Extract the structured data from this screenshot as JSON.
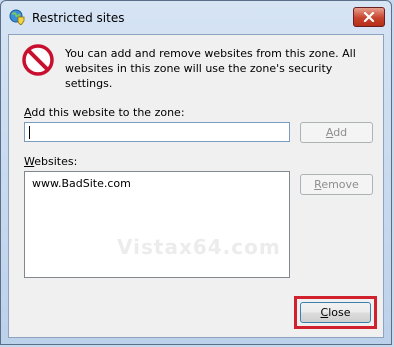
{
  "window": {
    "title": "Restricted sites"
  },
  "message": "You can add and remove websites from this zone. All websites in this zone will use the zone's security settings.",
  "add_section": {
    "label_access_key": "A",
    "label_rest": "dd this website to the zone:",
    "input_value": "",
    "add_button_access_key": "A",
    "add_button_rest": "dd"
  },
  "sites_section": {
    "label_access_key": "W",
    "label_rest": "ebsites:",
    "items": [
      "www.BadSite.com"
    ],
    "remove_button_access_key": "R",
    "remove_button_rest": "emove"
  },
  "close_button": {
    "access_key": "C",
    "rest": "lose"
  },
  "watermark": "Vistax64.com",
  "colors": {
    "highlight_box": "#d1212f",
    "no_entry_icon": "#c8102e"
  },
  "icons": [
    "globe-shield-icon",
    "close-x-icon",
    "no-entry-icon"
  ]
}
